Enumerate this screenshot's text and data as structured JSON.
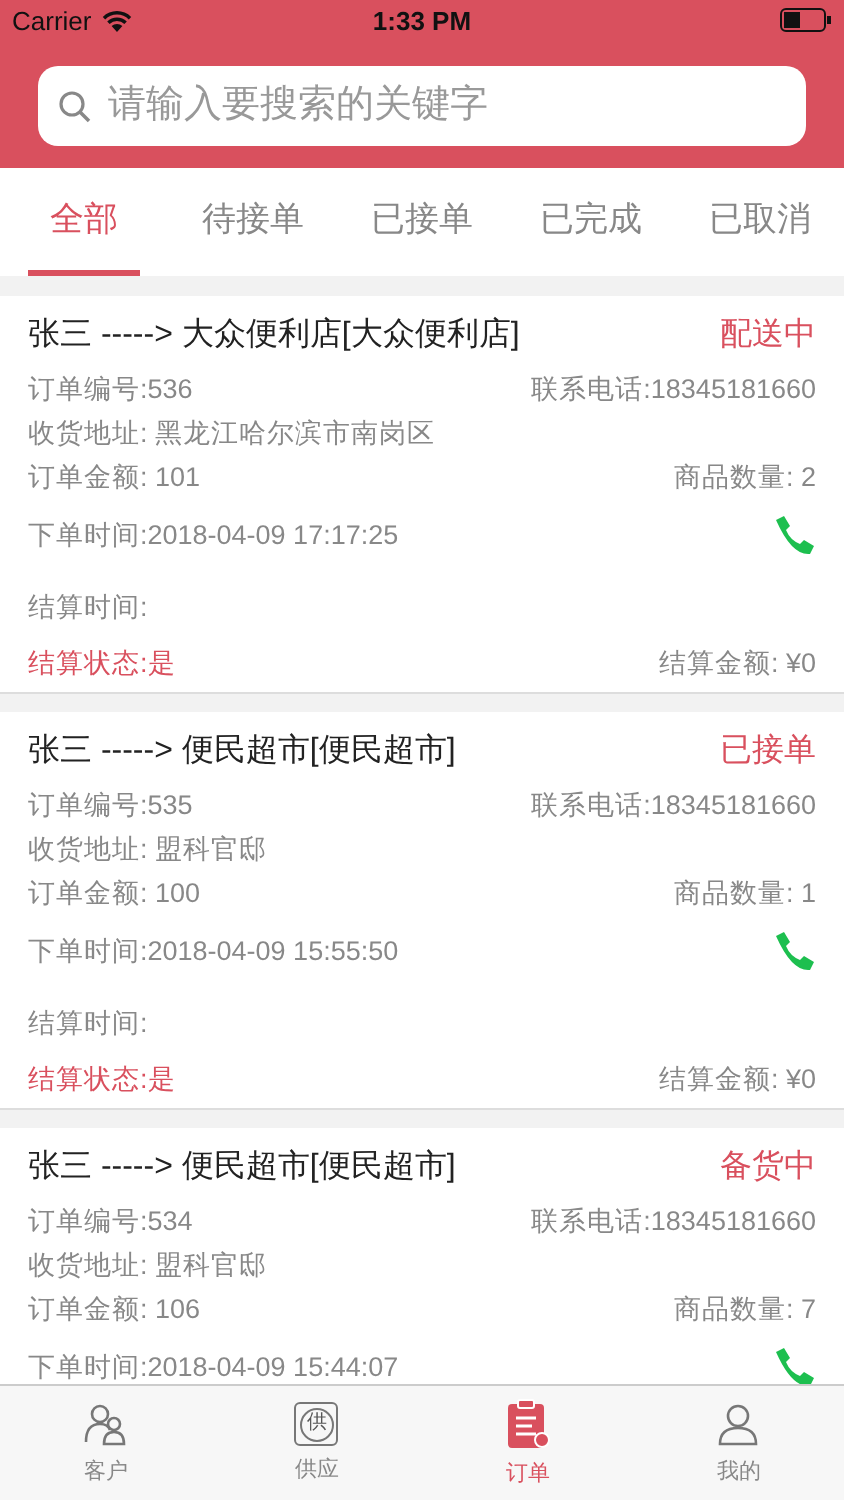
{
  "status_bar": {
    "carrier": "Carrier",
    "time": "1:33 PM"
  },
  "search": {
    "placeholder": "请输入要搜索的关键字"
  },
  "tabs": [
    {
      "label": "全部",
      "selected": true
    },
    {
      "label": "待接单",
      "selected": false
    },
    {
      "label": "已接单",
      "selected": false
    },
    {
      "label": "已完成",
      "selected": false
    },
    {
      "label": "已取消",
      "selected": false
    }
  ],
  "orders": [
    {
      "title": "张三 -----> 大众便利店[大众便利店]",
      "status": "配送中",
      "order_no": "订单编号:536",
      "phone": "联系电话:18345181660",
      "address": "收货地址: 黑龙江哈尔滨市南岗区",
      "amount": "订单金额: 101",
      "quantity": "商品数量: 2",
      "order_time": "下单时间:2018-04-09 17:17:25",
      "settle_time": "结算时间:",
      "settle_status": "结算状态:是",
      "settle_amount": "结算金额: ¥0"
    },
    {
      "title": "张三 -----> 便民超市[便民超市]",
      "status": "已接单",
      "order_no": "订单编号:535",
      "phone": "联系电话:18345181660",
      "address": "收货地址: 盟科官邸",
      "amount": "订单金额: 100",
      "quantity": "商品数量: 1",
      "order_time": "下单时间:2018-04-09 15:55:50",
      "settle_time": "结算时间:",
      "settle_status": "结算状态:是",
      "settle_amount": "结算金额: ¥0"
    },
    {
      "title": "张三 -----> 便民超市[便民超市]",
      "status": "备货中",
      "order_no": "订单编号:534",
      "phone": "联系电话:18345181660",
      "address": "收货地址: 盟科官邸",
      "amount": "订单金额: 106",
      "quantity": "商品数量: 7",
      "order_time": "下单时间:2018-04-09 15:44:07"
    }
  ],
  "tab_bar": [
    {
      "kind": "customers",
      "label": "客户",
      "selected": false
    },
    {
      "kind": "supply",
      "label": "供应",
      "badge": "供",
      "selected": false
    },
    {
      "kind": "orders",
      "label": "订单",
      "selected": true
    },
    {
      "kind": "me",
      "label": "我的",
      "selected": false
    }
  ]
}
